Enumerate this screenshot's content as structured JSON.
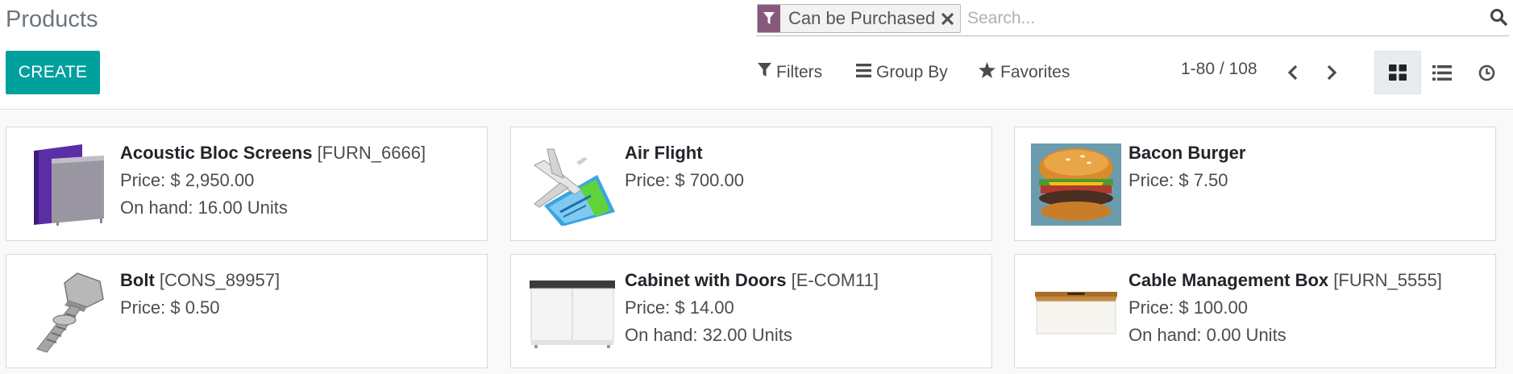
{
  "title": "Products",
  "search": {
    "facet_label": "Can be Purchased",
    "placeholder": "Search..."
  },
  "toolbar": {
    "create_label": "CREATE",
    "filters_label": "Filters",
    "groupby_label": "Group By",
    "favorites_label": "Favorites"
  },
  "pager": {
    "value": "1-80 / 108"
  },
  "products": [
    {
      "name": "Acoustic Bloc Screens",
      "ref": "[FURN_6666]",
      "price": "Price: $ 2,950.00",
      "onhand": "On hand: 16.00 Units"
    },
    {
      "name": "Air Flight",
      "ref": "",
      "price": "Price: $ 700.00",
      "onhand": ""
    },
    {
      "name": "Bacon Burger",
      "ref": "",
      "price": "Price: $ 7.50",
      "onhand": ""
    },
    {
      "name": "Bolt",
      "ref": "[CONS_89957]",
      "price": "Price: $ 0.50",
      "onhand": ""
    },
    {
      "name": "Cabinet with Doors",
      "ref": "[E-COM11]",
      "price": "Price: $ 14.00",
      "onhand": "On hand: 32.00 Units"
    },
    {
      "name": "Cable Management Box",
      "ref": "[FURN_5555]",
      "price": "Price: $ 100.00",
      "onhand": "On hand: 0.00 Units"
    }
  ],
  "colors": {
    "brand": "#875a7b",
    "primary": "#00a09d"
  }
}
